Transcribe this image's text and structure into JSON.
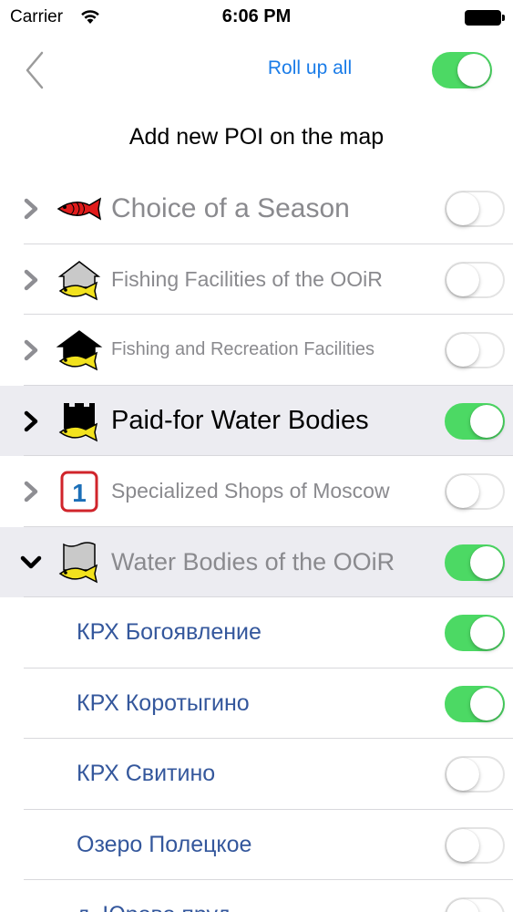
{
  "status_bar": {
    "carrier": "Carrier",
    "time": "6:06 PM"
  },
  "nav": {
    "roll_up_label": "Roll up all",
    "roll_up_toggle_on": true
  },
  "title": "Add new POI on the map",
  "categories": [
    {
      "label": "Choice of a Season",
      "icon": "red-fish-icon",
      "on": false,
      "expanded": false,
      "selected": false
    },
    {
      "label": "Fishing Facilities of the OOiR",
      "icon": "house-fish-icon",
      "on": false,
      "expanded": false,
      "selected": false
    },
    {
      "label": "Fishing and Recreation Facilities",
      "icon": "black-house-fish-icon",
      "on": false,
      "expanded": false,
      "selected": false
    },
    {
      "label": "Paid-for Water Bodies",
      "icon": "castle-fish-icon",
      "on": true,
      "expanded": false,
      "selected": true
    },
    {
      "label": "Specialized Shops of Moscow",
      "icon": "number-one-badge-icon",
      "badge_text": "1",
      "on": false,
      "expanded": false,
      "selected": false
    },
    {
      "label": "Water Bodies of the OOiR",
      "icon": "water-fish-icon",
      "on": true,
      "expanded": true,
      "selected": true
    }
  ],
  "sub_items": [
    {
      "label": "КРХ Богоявление",
      "on": true
    },
    {
      "label": "КРХ Коротыгино",
      "on": true
    },
    {
      "label": "КРХ Свитино",
      "on": false
    },
    {
      "label": "Озеро Полецкое",
      "on": false
    },
    {
      "label": "д. Юрово пруд",
      "on": false
    }
  ],
  "colors": {
    "accent": "#1a7ce8",
    "toggle_on": "#4cd964",
    "sub_label": "#34579c",
    "selected_row": "#ececf1"
  }
}
